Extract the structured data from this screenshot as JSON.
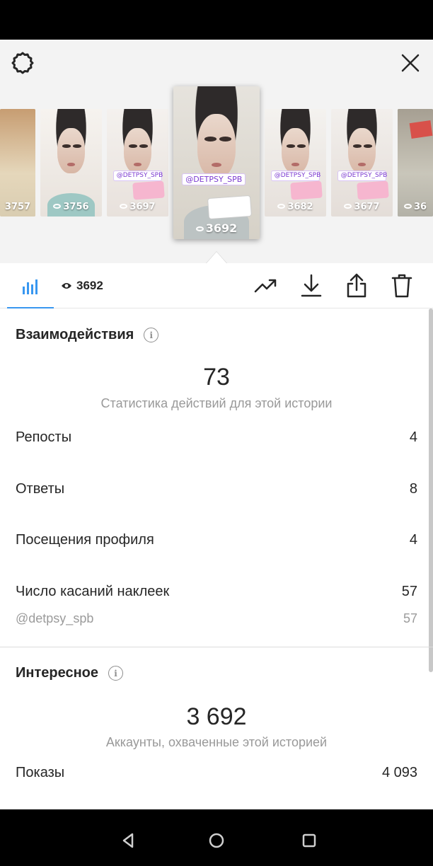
{
  "header": {
    "settings_icon": "gear-icon",
    "close_icon": "close-icon"
  },
  "stories": [
    {
      "views": "3757",
      "tag": ""
    },
    {
      "views": "3756",
      "tag": ""
    },
    {
      "views": "3697",
      "tag": "@DETPSY_SPB"
    },
    {
      "views": "3692",
      "tag": "@DETPSY_SPB",
      "selected": true
    },
    {
      "views": "3682",
      "tag": "@DETPSY_SPB"
    },
    {
      "views": "3677",
      "tag": "@DETPSY_SPB"
    },
    {
      "views": "36",
      "tag": ""
    }
  ],
  "toolbar": {
    "views_count": "3692",
    "icons": [
      "bar-chart-icon",
      "eye-icon",
      "trend-icon",
      "download-icon",
      "share-icon",
      "trash-icon"
    ]
  },
  "interactions": {
    "title": "Взаимодействия",
    "total": "73",
    "caption": "Статистика действий для этой истории",
    "rows": [
      {
        "label": "Репосты",
        "value": "4"
      },
      {
        "label": "Ответы",
        "value": "8"
      },
      {
        "label": "Посещения профиля",
        "value": "4"
      },
      {
        "label": "Число касаний наклеек",
        "value": "57"
      }
    ],
    "sub_row": {
      "label": "@detpsy_spb",
      "value": "57"
    }
  },
  "discovery": {
    "title": "Интересное",
    "total": "3 692",
    "caption": "Аккаунты, охваченные этой историей",
    "rows": [
      {
        "label": "Показы",
        "value": "4 093"
      }
    ]
  },
  "colors": {
    "accent": "#3897f0",
    "text": "#262626",
    "muted": "#999999"
  }
}
